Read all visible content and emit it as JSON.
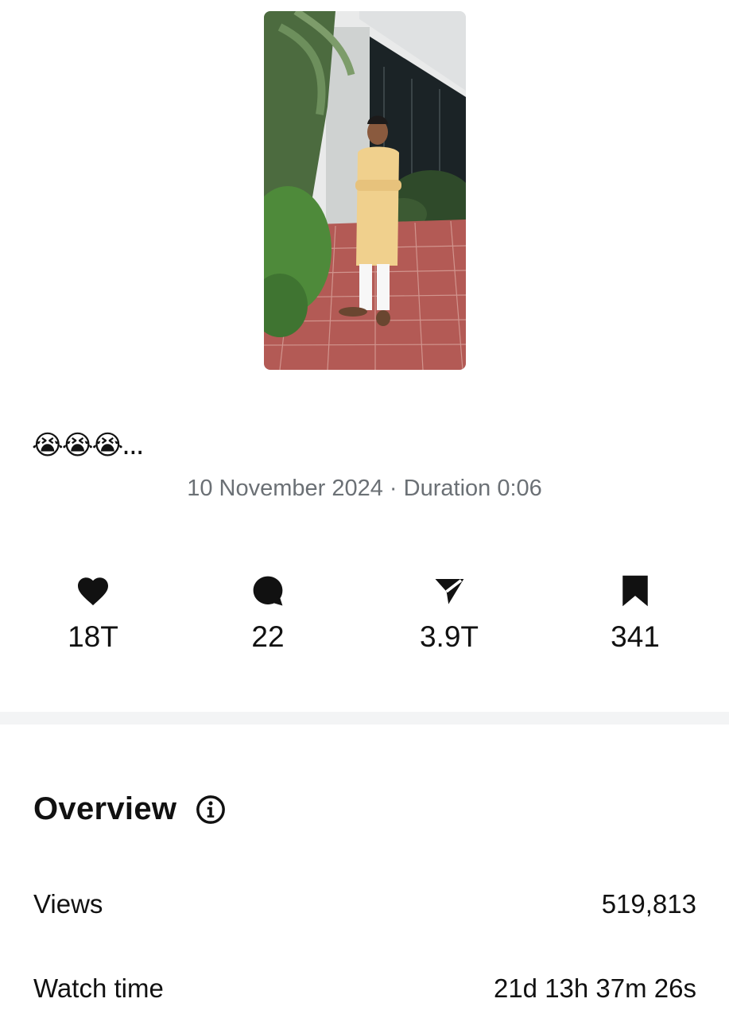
{
  "post": {
    "thumbnail_icon": "reel-thumbnail-photo",
    "caption": "😭😭😭...",
    "date": "10 November 2024",
    "separator": "·",
    "duration_label": "Duration",
    "duration": "0:06"
  },
  "stats": {
    "likes": {
      "icon": "heart-icon",
      "value": "18T"
    },
    "comments": {
      "icon": "comment-icon",
      "value": "22"
    },
    "shares": {
      "icon": "send-icon",
      "value": "3.9T"
    },
    "saves": {
      "icon": "bookmark-icon",
      "value": "341"
    }
  },
  "overview": {
    "title": "Overview",
    "info_icon": "info-icon",
    "rows": [
      {
        "label": "Views",
        "value": "519,813"
      },
      {
        "label": "Watch time",
        "value": "21d 13h 37m 26s"
      }
    ]
  },
  "colors": {
    "text": "#111111",
    "muted": "#6b7075",
    "divider": "#f3f4f5"
  }
}
